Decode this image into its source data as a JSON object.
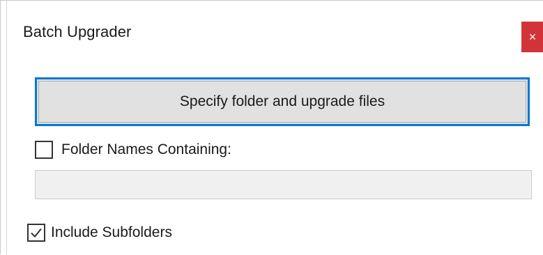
{
  "window": {
    "title": "Batch Upgrader",
    "close_glyph": "×",
    "close_color": "#d13438",
    "accent_color": "#0078d7"
  },
  "main": {
    "primary_button_label": "Specify folder and upgrade files",
    "folder_filter": {
      "label": "Folder Names Containing:",
      "checked": false,
      "input_value": "",
      "input_placeholder": ""
    },
    "include_subfolders": {
      "label": "Include Subfolders",
      "checked": true
    }
  },
  "icons": {
    "close": "close-icon",
    "checkmark": "checkmark-icon"
  }
}
